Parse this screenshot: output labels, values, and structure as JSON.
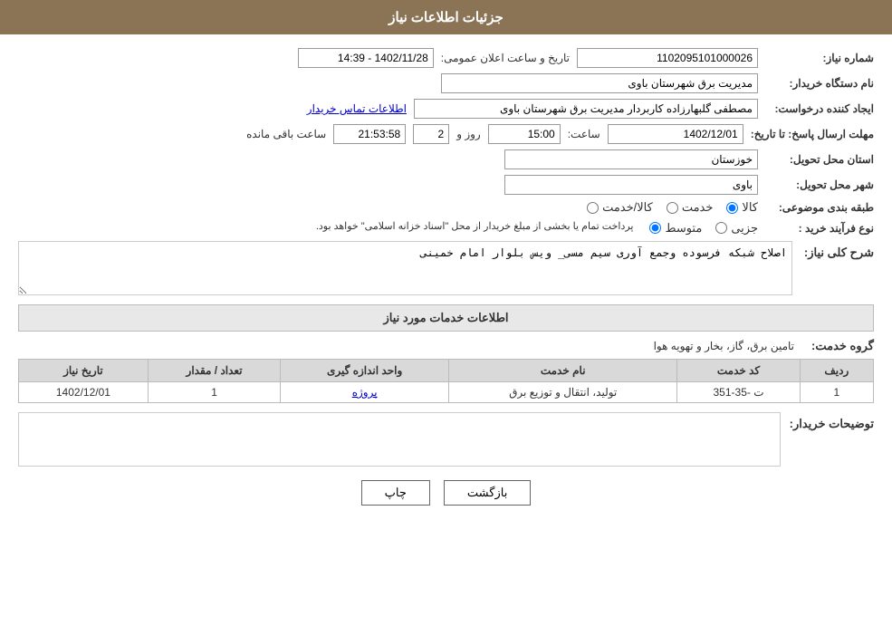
{
  "header": {
    "title": "جزئیات اطلاعات نیاز"
  },
  "form": {
    "need_number_label": "شماره نیاز:",
    "need_number_value": "1102095101000026",
    "announce_datetime_label": "تاریخ و ساعت اعلان عمومی:",
    "announce_datetime_value": "1402/11/28 - 14:39",
    "buyer_org_label": "نام دستگاه خریدار:",
    "buyer_org_value": "مدیریت برق شهرستان باوی",
    "requester_label": "ایجاد کننده درخواست:",
    "requester_value": "مصطفی گلبهارزاده کاربردار مدیریت برق شهرستان باوی",
    "contact_link": "اطلاعات تماس خریدار",
    "reply_deadline_label": "مهلت ارسال پاسخ: تا تاریخ:",
    "reply_date_value": "1402/12/01",
    "reply_time_label": "ساعت:",
    "reply_time_value": "15:00",
    "remaining_days_label": "روز و",
    "remaining_days_value": "2",
    "remaining_time_label": "ساعت باقی مانده",
    "remaining_time_value": "21:53:58",
    "province_label": "استان محل تحویل:",
    "province_value": "خوزستان",
    "city_label": "شهر محل تحویل:",
    "city_value": "باوی",
    "category_label": "طبقه بندی موضوعی:",
    "category_kala": "کالا",
    "category_khedmat": "خدمت",
    "category_kala_khedmat": "کالا/خدمت",
    "purchase_type_label": "نوع فرآیند خرید :",
    "purchase_type_jozi": "جزیی",
    "purchase_type_motevaset": "متوسط",
    "payment_note": "پرداخت تمام یا بخشی از مبلغ خریدار از محل \"اسناد خزانه اسلامی\" خواهد بود.",
    "need_description_label": "شرح کلی نیاز:",
    "need_description_value": "اصلاح شبکه فرسوده وجمع آوری سیم مسی_ ویس بلوار امام خمینی",
    "services_section_title": "اطلاعات خدمات مورد نیاز",
    "service_group_label": "گروه خدمت:",
    "service_group_value": "تامین برق، گاز، بخار و تهویه هوا",
    "table": {
      "headers": [
        "ردیف",
        "کد خدمت",
        "نام خدمت",
        "واحد اندازه گیری",
        "تعداد / مقدار",
        "تاریخ نیاز"
      ],
      "rows": [
        {
          "row_num": "1",
          "service_code": "ت -35-351",
          "service_name": "تولید، انتقال و توزیع برق",
          "unit": "پروژه",
          "quantity": "1",
          "date": "1402/12/01"
        }
      ]
    },
    "buyer_notes_label": "توضیحات خریدار:",
    "buyer_notes_value": ""
  },
  "buttons": {
    "print_label": "چاپ",
    "back_label": "بازگشت"
  }
}
